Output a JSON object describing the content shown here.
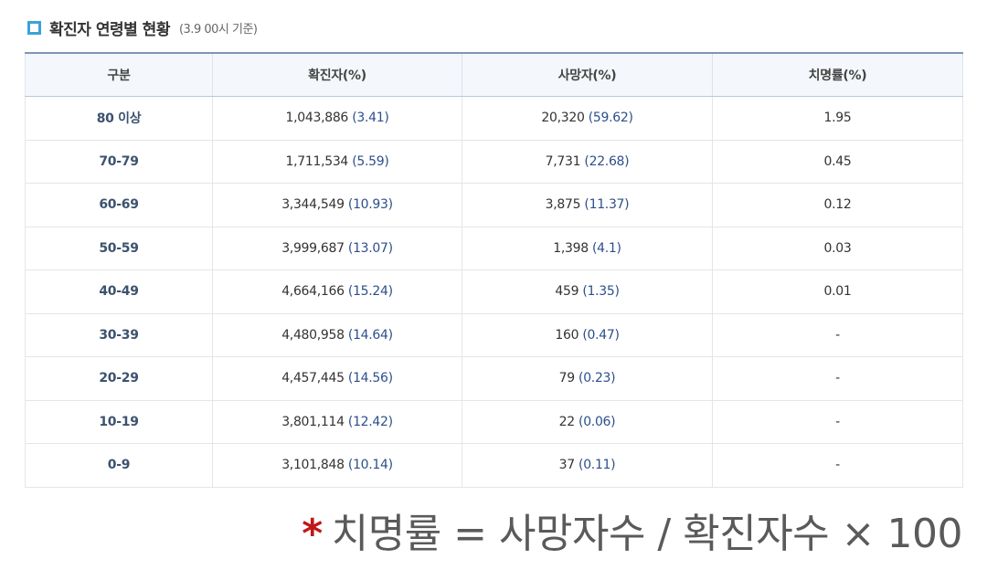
{
  "header": {
    "icon": "square-bullet-icon",
    "icon_color": "#3aa3d8",
    "title": "확진자 연령별 현황",
    "subtitle": "(3.9 00시 기준)"
  },
  "table": {
    "columns": [
      "구분",
      "확진자(%)",
      "사망자(%)",
      "치명률(%)"
    ],
    "rows": [
      {
        "age": "80 이상",
        "confirmed": "1,043,886",
        "confirmed_pct": "(3.41)",
        "deaths": "20,320",
        "deaths_pct": "(59.62)",
        "fatality": "1.95"
      },
      {
        "age": "70-79",
        "confirmed": "1,711,534",
        "confirmed_pct": "(5.59)",
        "deaths": "7,731",
        "deaths_pct": "(22.68)",
        "fatality": "0.45"
      },
      {
        "age": "60-69",
        "confirmed": "3,344,549",
        "confirmed_pct": "(10.93)",
        "deaths": "3,875",
        "deaths_pct": "(11.37)",
        "fatality": "0.12"
      },
      {
        "age": "50-59",
        "confirmed": "3,999,687",
        "confirmed_pct": "(13.07)",
        "deaths": "1,398",
        "deaths_pct": "(4.1)",
        "fatality": "0.03"
      },
      {
        "age": "40-49",
        "confirmed": "4,664,166",
        "confirmed_pct": "(15.24)",
        "deaths": "459",
        "deaths_pct": "(1.35)",
        "fatality": "0.01"
      },
      {
        "age": "30-39",
        "confirmed": "4,480,958",
        "confirmed_pct": "(14.64)",
        "deaths": "160",
        "deaths_pct": "(0.47)",
        "fatality": "-"
      },
      {
        "age": "20-29",
        "confirmed": "4,457,445",
        "confirmed_pct": "(14.56)",
        "deaths": "79",
        "deaths_pct": "(0.23)",
        "fatality": "-"
      },
      {
        "age": "10-19",
        "confirmed": "3,801,114",
        "confirmed_pct": "(12.42)",
        "deaths": "22",
        "deaths_pct": "(0.06)",
        "fatality": "-"
      },
      {
        "age": "0-9",
        "confirmed": "3,101,848",
        "confirmed_pct": "(10.14)",
        "deaths": "37",
        "deaths_pct": "(0.11)",
        "fatality": "-"
      }
    ]
  },
  "footnote": {
    "asterisk": "*",
    "asterisk_color": "#c01818",
    "formula": "치명률 = 사망자수 / 확진자수 × 100"
  },
  "colors": {
    "accent_border": "#7e96b5",
    "header_bg": "#f4f7fb",
    "category_text": "#3c526e",
    "percent_text": "#2c4f8c"
  }
}
